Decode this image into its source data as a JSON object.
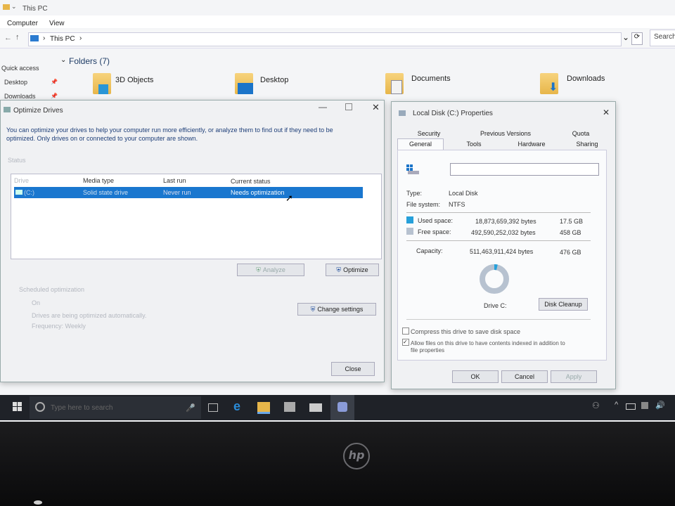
{
  "explorer": {
    "title": "This PC",
    "ribbon_tabs": [
      "Computer",
      "View"
    ],
    "address": "This PC",
    "search_placeholder": "Search",
    "nav": [
      "Quick access",
      "Desktop",
      "Downloads"
    ],
    "folders_header": "Folders (7)",
    "folders": [
      "3D Objects",
      "Desktop",
      "Documents",
      "Downloads"
    ]
  },
  "optimize": {
    "title": "Optimize Drives",
    "description_line1": "You can optimize your drives to help your computer run more efficiently, or analyze them to find out if they need to be",
    "description_line2": "optimized. Only drives on or connected to your computer are shown.",
    "status_label": "Status",
    "columns": [
      "Drive",
      "Media type",
      "Last run",
      "Current status"
    ],
    "rows": [
      {
        "drive": "(C:)",
        "media": "Solid state drive",
        "last_run": "Never run",
        "status": "Needs optimization"
      }
    ],
    "analyze": "Analyze",
    "optimize": "Optimize",
    "scheduled_label": "Scheduled optimization",
    "sched_on": "On",
    "sched_auto": "Drives are being optimized automatically.",
    "sched_freq": "Frequency: Weekly",
    "change_settings": "Change settings",
    "close": "Close"
  },
  "properties": {
    "title": "Local Disk (C:) Properties",
    "tabs_row1": [
      "Security",
      "Previous Versions",
      "Quota"
    ],
    "tabs_row2": [
      "General",
      "Tools",
      "Hardware",
      "Sharing"
    ],
    "active_tab": "General",
    "type_label": "Type:",
    "type_value": "Local Disk",
    "fs_label": "File system:",
    "fs_value": "NTFS",
    "used_label": "Used space:",
    "used_bytes": "18,873,659,392 bytes",
    "used_gb": "17.5 GB",
    "free_label": "Free space:",
    "free_bytes": "492,590,252,032 bytes",
    "free_gb": "458 GB",
    "cap_label": "Capacity:",
    "cap_bytes": "511,463,911,424 bytes",
    "cap_gb": "476 GB",
    "drive_label": "Drive C:",
    "disk_cleanup": "Disk Cleanup",
    "compress": "Compress this drive to save disk space",
    "index_line1": "Allow files on this drive to have contents indexed in addition to",
    "index_line2": "file properties",
    "ok": "OK",
    "cancel": "Cancel",
    "apply": "Apply",
    "used_fraction": 0.037,
    "colors": {
      "used": "#26a0da",
      "free": "#b7c2d0"
    }
  },
  "taskbar": {
    "search_placeholder": "Type here to search"
  },
  "bezel": {
    "brand": "hp"
  }
}
